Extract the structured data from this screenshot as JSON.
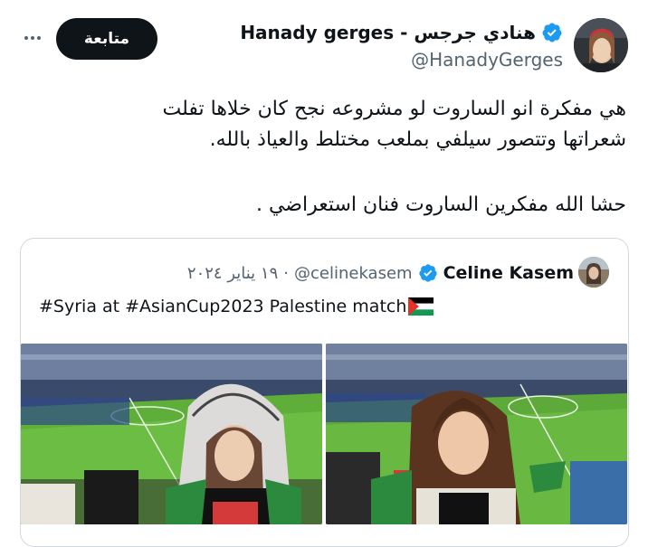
{
  "tweet": {
    "author_name": "Hanady gerges - هنادي جرجس",
    "author_handle": "@HanadyGerges",
    "follow_label": "متابعة",
    "lines": [
      "هي مفكرة انو الساروت لو مشروعه نجح كان خلاها تفلت",
      "شعراتها وتتصور سيلفي بملعب مختلط والعياذ بالله.",
      "حشا الله مفكرين الساروت فنان استعراضي ."
    ]
  },
  "quote": {
    "author_name": "Celine Kasem",
    "author_handle": "@celinekasem",
    "date": "١٩ يناير ٢٠٢٤",
    "text": "#Syria at #AsianCup2023 Palestine match",
    "flag_icon": "palestine-flag-icon"
  },
  "colors": {
    "verified": "#1d9bf0",
    "text": "#0f1419",
    "secondary": "#536471",
    "border": "#cfd9de",
    "button": "#0f1419"
  }
}
